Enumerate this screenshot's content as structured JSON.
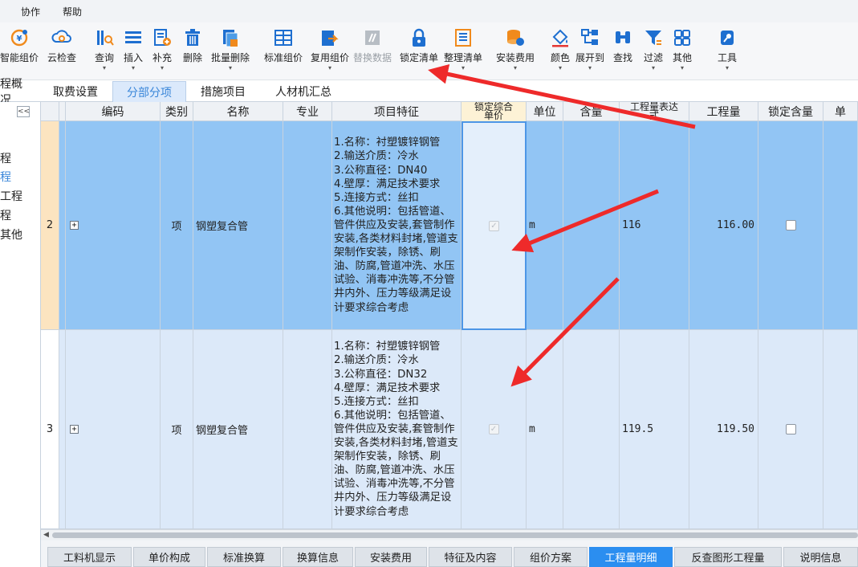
{
  "menu": [
    "协作",
    "帮助"
  ],
  "toolbar": [
    {
      "label": "智能组价",
      "icon": "smart-pricing-icon"
    },
    {
      "label": "云检查",
      "icon": "cloud-check-icon"
    },
    {
      "label": "查询",
      "icon": "query-icon"
    },
    {
      "label": "插入",
      "icon": "insert-icon"
    },
    {
      "label": "补充",
      "icon": "supplement-icon"
    },
    {
      "label": "删除",
      "icon": "trash-icon"
    },
    {
      "label": "批量删除",
      "icon": "batch-delete-icon"
    },
    {
      "label": "标准组价",
      "icon": "standard-pricing-icon"
    },
    {
      "label": "复用组价",
      "icon": "reuse-pricing-icon"
    },
    {
      "label": "替换数据",
      "icon": "replace-data-icon"
    },
    {
      "label": "锁定清单",
      "icon": "lock-icon"
    },
    {
      "label": "整理清单",
      "icon": "organize-list-icon"
    },
    {
      "label": "安装费用",
      "icon": "install-fee-icon"
    },
    {
      "label": "颜色",
      "icon": "paint-bucket-icon"
    },
    {
      "label": "展开到",
      "icon": "expand-tree-icon"
    },
    {
      "label": "查找",
      "icon": "binoculars-icon"
    },
    {
      "label": "过滤",
      "icon": "filter-icon"
    },
    {
      "label": "其他",
      "icon": "grid-apps-icon"
    },
    {
      "label": "工具",
      "icon": "tools-icon"
    }
  ],
  "tabs": [
    "程概况",
    "取费设置",
    "分部分项",
    "措施项目",
    "人材机汇总"
  ],
  "left_panel": {
    "items": [
      "程",
      "程",
      "工程",
      "程",
      "其他"
    ]
  },
  "columns": [
    "编码",
    "类别",
    "名称",
    "专业",
    "项目特征",
    "锁定综合单价",
    "单位",
    "含量",
    "工程量表达式",
    "工程量",
    "锁定含量",
    "单"
  ],
  "rows": [
    {
      "num": "2",
      "expander": "+",
      "category": "项",
      "name": "钢塑复合管",
      "features": "1.名称：衬塑镀锌钢管\n2.输送介质：冷水\n3.公称直径：DN40\n4.壁厚：满足技术要求\n5.连接方式：丝扣\n6.其他说明：包括管道、管件供应及安装,套管制作安装,各类材料封堵,管道支架制作安装，除锈、刷油、防腐,管道冲洗、水压试验、消毒冲洗等,不分管井内外、压力等级满足设计要求综合考虑",
      "unit": "m",
      "expr": "116",
      "quantity": "116.00"
    },
    {
      "num": "3",
      "expander": "+",
      "category": "项",
      "name": "钢塑复合管",
      "features": "1.名称：衬塑镀锌钢管\n2.输送介质：冷水\n3.公称直径：DN32\n4.壁厚：满足技术要求\n5.连接方式：丝扣\n6.其他说明：包括管道、管件供应及安装,套管制作安装,各类材料封堵,管道支架制作安装，除锈、刷油、防腐,管道冲洗、水压试验、消毒冲洗等,不分管井内外、压力等级满足设计要求综合考虑",
      "unit": "m",
      "expr": "119.5",
      "quantity": "119.50"
    }
  ],
  "bottom_tabs": [
    "工料机显示",
    "单价构成",
    "标准换算",
    "换算信息",
    "安装费用",
    "特征及内容",
    "组价方案",
    "工程量明细",
    "反查图形工程量",
    "说明信息"
  ],
  "colors": {
    "accent": "#2b8ef0",
    "selected_row": "#92c5f4",
    "row": "#dce9f9",
    "arrow": "#ee2a2a"
  }
}
